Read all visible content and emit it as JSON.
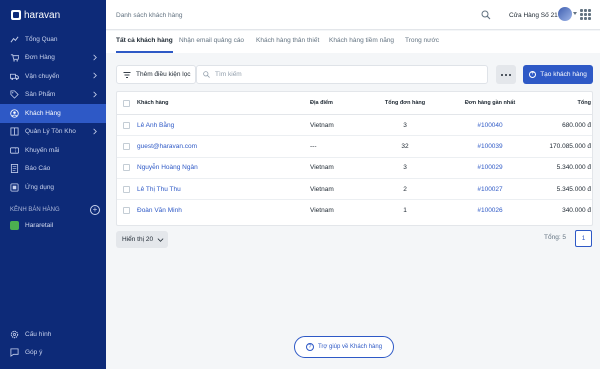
{
  "brand": {
    "logo_text": "haravan"
  },
  "sidebar": {
    "items": [
      {
        "label": "Tổng Quan",
        "icon": "dashboard-icon",
        "chevron": false
      },
      {
        "label": "Đơn Hàng",
        "icon": "cart-icon",
        "chevron": true
      },
      {
        "label": "Vận chuyển",
        "icon": "truck-icon",
        "chevron": true
      },
      {
        "label": "Sản Phẩm",
        "icon": "tag-icon",
        "chevron": true
      },
      {
        "label": "Khách Hàng",
        "icon": "customer-icon",
        "chevron": false,
        "active": true
      },
      {
        "label": "Quản Lý Tồn Kho",
        "icon": "inventory-icon",
        "chevron": true
      },
      {
        "label": "Khuyến mãi",
        "icon": "promotion-icon",
        "chevron": false
      },
      {
        "label": "Báo Cáo",
        "icon": "report-icon",
        "chevron": false
      },
      {
        "label": "Ứng dụng",
        "icon": "apps-icon",
        "chevron": false
      }
    ],
    "section_label": "KÊNH BÁN HÀNG",
    "channel": {
      "label": "Hararetail"
    },
    "bottom": [
      {
        "label": "Cấu hình",
        "icon": "settings-icon"
      },
      {
        "label": "Góp ý",
        "icon": "feedback-icon"
      }
    ]
  },
  "header": {
    "breadcrumb": "Danh sách khách hàng",
    "store_name": "Cửa Hàng Số 21"
  },
  "tabs": [
    {
      "label": "Tất cả khách hàng",
      "active": true
    },
    {
      "label": "Nhận email quảng cáo"
    },
    {
      "label": "Khách hàng thân thiết"
    },
    {
      "label": "Khách hàng tiềm năng"
    },
    {
      "label": "Trong nước"
    }
  ],
  "toolbar": {
    "filter_label": "Thêm điều kiện lọc",
    "search_placeholder": "Tìm kiếm",
    "create_label": "Tạo khách hàng"
  },
  "table": {
    "columns": [
      "Khách hàng",
      "Địa điểm",
      "Tổng đơn hàng",
      "Đơn hàng gần nhất",
      "Tổng"
    ],
    "rows": [
      {
        "name": "Lê Anh Bằng",
        "location": "Vietnam",
        "orders": "3",
        "last_order": "#100040",
        "total": "680.000 đ"
      },
      {
        "name": "guest@haravan.com",
        "location": "---",
        "orders": "32",
        "last_order": "#100039",
        "total": "170.085.000 đ"
      },
      {
        "name": "Nguyễn Hoàng Ngân",
        "location": "Vietnam",
        "orders": "3",
        "last_order": "#100029",
        "total": "5.340.000 đ"
      },
      {
        "name": "Lê Thị Thu Thu",
        "location": "Vietnam",
        "orders": "2",
        "last_order": "#100027",
        "total": "5.345.000 đ"
      },
      {
        "name": "Đoàn Văn Minh",
        "location": "Vietnam",
        "orders": "1",
        "last_order": "#100026",
        "total": "340.000 đ"
      }
    ]
  },
  "pagination": {
    "page_size_label": "Hiển thị 20",
    "total_label": "Tổng: 5",
    "current_page": "1"
  },
  "help": {
    "label": "Trợ giúp về Khách hàng"
  },
  "colors": {
    "sidebar": "#0d2a78",
    "accent": "#2e59c6",
    "active_item": "#2e59c6"
  }
}
